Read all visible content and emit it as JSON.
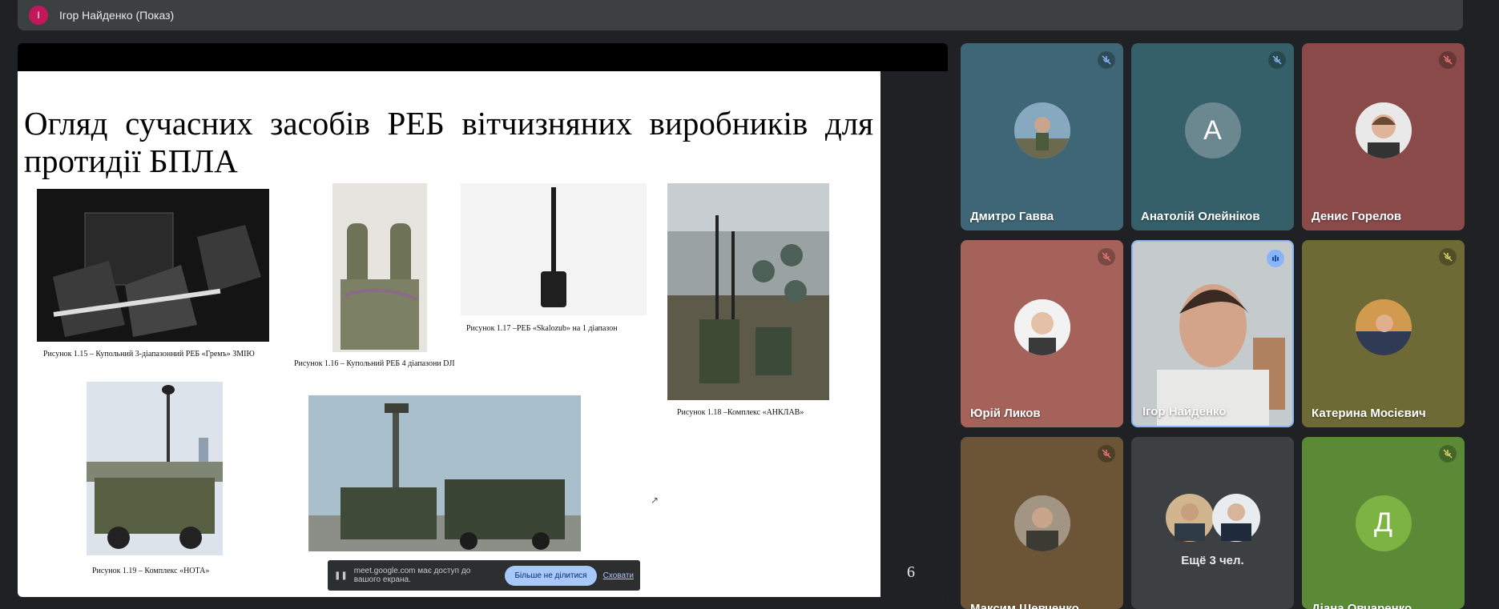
{
  "header": {
    "avatar_initial": "І",
    "presenter_label": "Ігор Найденко (Показ)"
  },
  "slide": {
    "title": "Огляд сучасних засобів РЕБ вітчизняних виробників для протидії БПЛА",
    "page_number": "6",
    "captions": [
      "Рисунок 1.15 – Купольний 3-діапазонний РЕБ «Гремъ» ЗМІЮ",
      "Рисунок 1.16 – Купольний РЕБ 4 діапазони DJI",
      "Рисунок 1.17 –РЕБ «Skalozub» на 1 діапазон",
      "Рисунок 1.18 –Комплекс «АНКЛАВ»",
      "Рисунок 1.19 – Комплекс «НОТА»"
    ]
  },
  "share_banner": {
    "text": "meet.google.com має доступ до вашого екрана.",
    "stop_label": "Більше не ділитися",
    "hide_label": "Сховати"
  },
  "participants": [
    {
      "name": "Дмитро Гавва",
      "muted": true,
      "bg": "#3e6676",
      "avatar": "photo"
    },
    {
      "name": "Анатолій Олейніков",
      "muted": true,
      "bg": "#35606a",
      "avatar": "letter",
      "letter": "А",
      "letter_bg": "#6b8790"
    },
    {
      "name": "Денис Горелов",
      "muted": true,
      "bg": "#8a4a4a",
      "avatar": "photo"
    },
    {
      "name": "Юрій Ликов",
      "muted": true,
      "bg": "#a4625a",
      "avatar": "photo"
    },
    {
      "name": "Ігор Найденко",
      "muted": false,
      "bg": "#b9bfc2",
      "avatar": "video"
    },
    {
      "name": "Катерина Мосієвич",
      "muted": true,
      "bg": "#6e6a36",
      "avatar": "photo"
    },
    {
      "name": "Максим Шевченко",
      "muted": true,
      "bg": "#6b5536",
      "avatar": "photo"
    },
    {
      "name": "",
      "muted": false,
      "bg": "#3c4043",
      "avatar": "group"
    },
    {
      "name": "Діана Овчаренко",
      "muted": true,
      "bg": "#5b8a37",
      "avatar": "letter",
      "letter": "Д",
      "letter_bg": "#7cb342"
    }
  ],
  "more_label": "Ещё 3 чел.",
  "colors": {
    "mic_muted_red": "#e57373",
    "mic_muted_yellow": "#d4d06a",
    "speaking": "#8ab4f8"
  }
}
